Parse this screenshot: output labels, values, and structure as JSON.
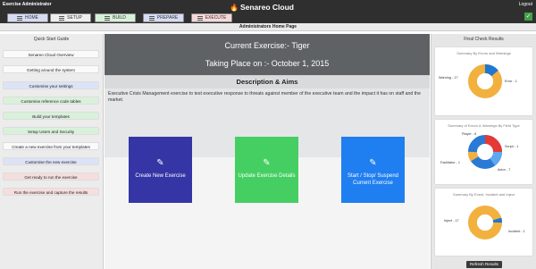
{
  "app": {
    "user_label": "Exercise Administrator",
    "logo_text": "Senareo Cloud",
    "logout_label": "Logout"
  },
  "nav": [
    {
      "label": "HOME",
      "color": "#d6dcf4"
    },
    {
      "label": "SETUP",
      "color": "#eeeeee"
    },
    {
      "label": "BUILD",
      "color": "#d7f1d8"
    },
    {
      "label": "PREPARE",
      "color": "#d6dcf4"
    },
    {
      "label": "EXECUTE",
      "color": "#f7d8d8"
    }
  ],
  "subheader": "Administrators Home Page",
  "quick_start": {
    "title": "Quick Start Guide",
    "items": [
      {
        "label": "Senareo Cloud Overview",
        "color": "#fafafa"
      },
      {
        "label": "Getting around the system",
        "color": "#fafafa"
      },
      {
        "label": "Customise your settings",
        "color": "#dde3f7"
      },
      {
        "label": "Customise reference code tables",
        "color": "#d9f1da"
      },
      {
        "label": "Build your templates",
        "color": "#d9f1da"
      },
      {
        "label": "Setup Users and Security",
        "color": "#d9f1da"
      },
      {
        "label": "Create a new exercise from your templates",
        "color": "#fafafa"
      },
      {
        "label": "Customise the new exercise",
        "color": "#dde3f7"
      },
      {
        "label": "Get ready to run the exercise",
        "color": "#f6dede"
      },
      {
        "label": "Run the exercise and capture the results",
        "color": "#f6dede"
      }
    ]
  },
  "exercise": {
    "current_line": "Current Exercise:-   Tiger",
    "place_line": "Taking Place on :-   October 1, 2015"
  },
  "description": {
    "heading": "Description & Aims",
    "text": "Executive Crisis Management exercise to test executive response to threats against member of the executive team and the impact it has on staff and the market."
  },
  "tiles": [
    {
      "label": "Create New Exercise",
      "color": "#3535a6",
      "icon": "pencil-icon"
    },
    {
      "label": "Update Exercise Details",
      "color": "#45cf62",
      "icon": "pencil-icon"
    },
    {
      "label": "Start / Stop/ Suspend Current Exercise",
      "color": "#1f7ef0",
      "icon": "pencil-icon"
    }
  ],
  "final_check": {
    "title": "Final Check Results",
    "refresh_label": "Refresh Results",
    "cards": [
      {
        "title": "Summary By Errors and Warnings",
        "labels": [
          "Warning - 17",
          "Error - 1"
        ]
      },
      {
        "title": "Summary of Errors & Warnings By Field Type",
        "labels": [
          "Player - 6",
          "Script - 1",
          "Facilitator - 1",
          "Actor - 7"
        ]
      },
      {
        "title": "Summary By Event, Incident and Inject",
        "labels": [
          "Inject - 17",
          "Incident - 1"
        ]
      }
    ]
  }
}
